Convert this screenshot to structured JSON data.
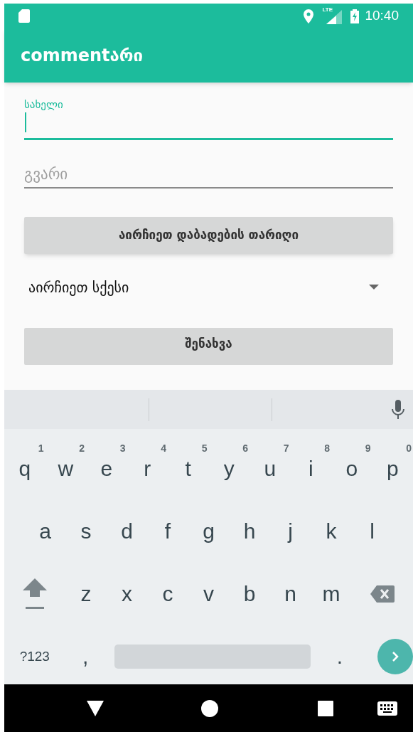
{
  "status_bar": {
    "network": "LTE",
    "time": "10:40"
  },
  "app_bar": {
    "title": "commentარი"
  },
  "form": {
    "fields": [
      {
        "label": "სახელი",
        "focused": true
      },
      {
        "placeholder": "გვარი",
        "focused": false
      }
    ],
    "date_button": "აირჩიეთ დაბადების თარიღი",
    "spinner": {
      "value": "აირჩიეთ სქესი"
    },
    "save_button": "შენახვა"
  },
  "keyboard": {
    "rows": [
      [
        {
          "kind": "letter",
          "label": "q",
          "hint": "1"
        },
        {
          "kind": "letter",
          "label": "w",
          "hint": "2"
        },
        {
          "kind": "letter",
          "label": "e",
          "hint": "3"
        },
        {
          "kind": "letter",
          "label": "r",
          "hint": "4"
        },
        {
          "kind": "letter",
          "label": "t",
          "hint": "5"
        },
        {
          "kind": "letter",
          "label": "y",
          "hint": "6"
        },
        {
          "kind": "letter",
          "label": "u",
          "hint": "7"
        },
        {
          "kind": "letter",
          "label": "i",
          "hint": "8"
        },
        {
          "kind": "letter",
          "label": "o",
          "hint": "9"
        },
        {
          "kind": "letter",
          "label": "p",
          "hint": "0"
        }
      ],
      [
        {
          "kind": "letter",
          "label": "a"
        },
        {
          "kind": "letter",
          "label": "s"
        },
        {
          "kind": "letter",
          "label": "d"
        },
        {
          "kind": "letter",
          "label": "f"
        },
        {
          "kind": "letter",
          "label": "g"
        },
        {
          "kind": "letter",
          "label": "h"
        },
        {
          "kind": "letter",
          "label": "j"
        },
        {
          "kind": "letter",
          "label": "k"
        },
        {
          "kind": "letter",
          "label": "l"
        }
      ],
      [
        {
          "kind": "shift"
        },
        {
          "kind": "letter",
          "label": "z"
        },
        {
          "kind": "letter",
          "label": "x"
        },
        {
          "kind": "letter",
          "label": "c"
        },
        {
          "kind": "letter",
          "label": "v"
        },
        {
          "kind": "letter",
          "label": "b"
        },
        {
          "kind": "letter",
          "label": "n"
        },
        {
          "kind": "letter",
          "label": "m"
        },
        {
          "kind": "backspace"
        }
      ],
      [
        {
          "kind": "symbols",
          "label": "?123"
        },
        {
          "kind": "letter",
          "label": ","
        },
        {
          "kind": "space"
        },
        {
          "kind": "letter",
          "label": "."
        },
        {
          "kind": "enter"
        }
      ]
    ]
  }
}
